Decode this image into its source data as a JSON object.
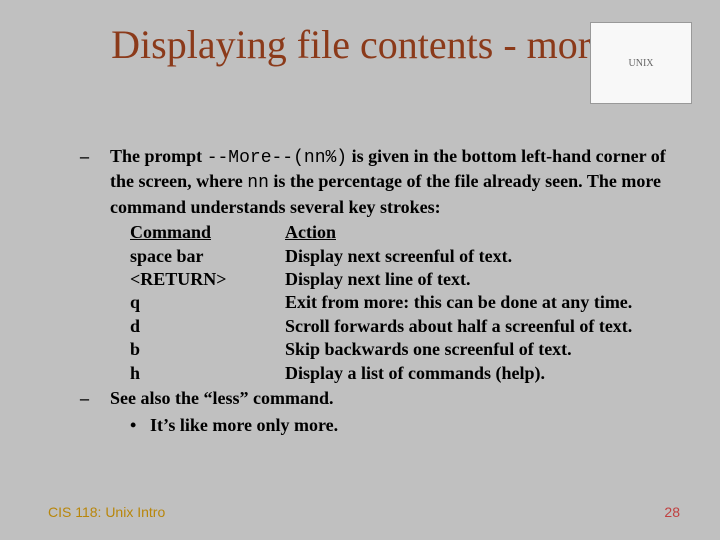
{
  "title": "Displaying file contents - more",
  "mascot_alt": "UNIX",
  "paragraph": {
    "p1a": "The prompt ",
    "p1b": "--More--(nn%)",
    "p1c": " is given in the bottom left-hand corner of the screen, where ",
    "p1d": "nn",
    "p1e": " is the percentage of the file already seen.  The more command understands several key strokes:"
  },
  "table": {
    "h1": "Command",
    "h2": "Action",
    "rows": [
      {
        "c": "space bar",
        "a": "Display next screenful of text."
      },
      {
        "c": "<RETURN>",
        "a": "Display next line of text."
      },
      {
        "c": "q",
        "a": "Exit from more: this can be done at any time."
      },
      {
        "c": "d",
        "a": "Scroll forwards about half a screenful of text."
      },
      {
        "c": "b",
        "a": "Skip backwards one screenful of text."
      },
      {
        "c": "h",
        "a": "Display a list of commands (help)."
      }
    ]
  },
  "see_also": "See also the “less” command.",
  "sub_bullet": "It’s like more only more.",
  "footer_left": "CIS 118: Unix Intro",
  "footer_right": "28"
}
